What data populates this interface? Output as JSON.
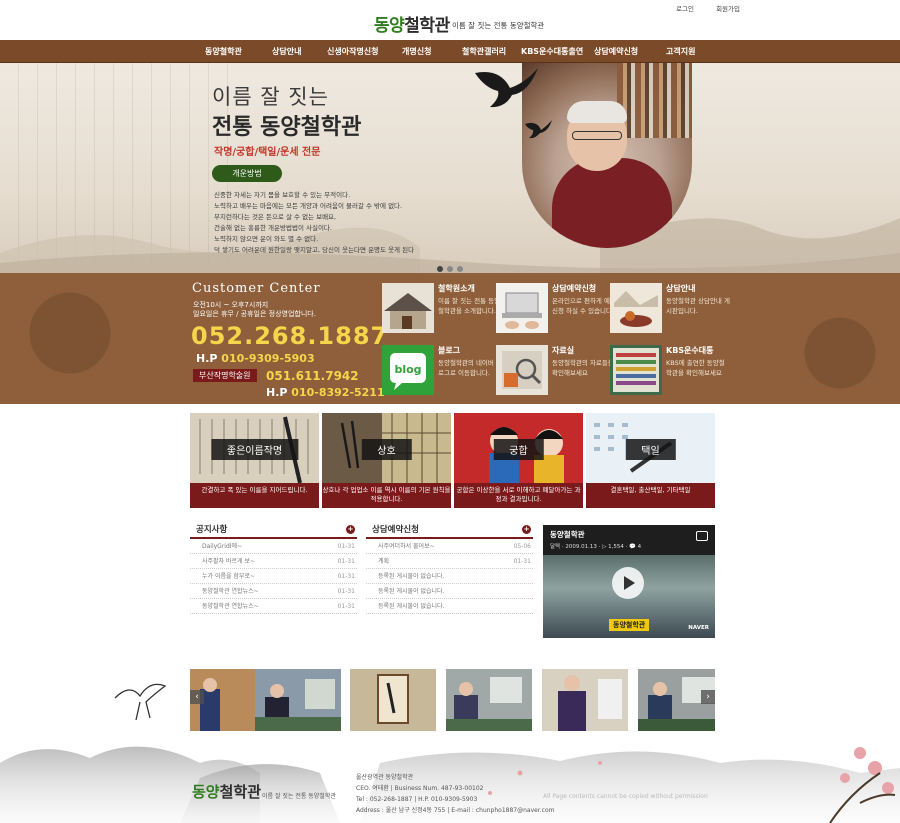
{
  "header": {
    "logo_main": "동양",
    "logo_dark": "철학관",
    "slogan": "이름 잘 짓는 전통 동양철학관",
    "login": "로그인",
    "join": "회원가입"
  },
  "nav": {
    "items": [
      "동양철학관",
      "상담안내",
      "신생아작명신청",
      "개명신청",
      "철학관갤러리",
      "KBS운수대통출연",
      "상담예약신청",
      "고객지원"
    ]
  },
  "hero": {
    "title1": "이름 잘 짓는",
    "title2": "전통 동양철학관",
    "subtitle": "작명/궁합/택일/운세 전문",
    "button": "개운방법",
    "lines": [
      "신중한 자세는 자기 몸을 보호할 수 있는 무적이다.",
      "노력하고 배우는 마음에는 모든 개양과 어려움이 물러갈 수 밖에 없다.",
      "부지런하다는 것은 돈으로 살 수 없는 보배요,",
      "건술해 없는 홍륭한 개운방법법이 사실이다.",
      "노력하지 않으면 운이 와도 별 수 없다.",
      "덕 쌓기도 어려운데 원한일랑 맺지말고, 당신이 웃는다면 운명도 웃게 된다"
    ]
  },
  "customer_center": {
    "title": "Customer Center",
    "hours1": "오전10시 ~ 오후7시까지",
    "hours2": "일요일은 휴무 / 공휴일은 정상영업합니다.",
    "phone": "052.268.1887",
    "hp1_label": "H.P",
    "hp1": "010-9309-5903",
    "branch": "부산작명학술원",
    "phone2": "051.611.7942",
    "hp2_label": "H.P",
    "hp2": "010-8392-5211"
  },
  "services": [
    {
      "title": "철학원소개",
      "desc": "이름 잘 짓는 전통 동양철학관을 소개합니다."
    },
    {
      "title": "상담예약신청",
      "desc": "온라인으로 편하게 예약신청 하실 수 있습니다."
    },
    {
      "title": "상담안내",
      "desc": "동양철학관 상담안내 게시판입니다."
    },
    {
      "title": "블로그",
      "desc": "동양철학관의 네이버 블로그로 이동합니다."
    },
    {
      "title": "자료실",
      "desc": "동양철학관의 자료들을 확인해보세요"
    },
    {
      "title": "KBS운수대통",
      "desc": "KBS에 출연한 동양철학관을 확인해보세요"
    }
  ],
  "blog_badge": "blog",
  "tiles": [
    {
      "label": "좋은이름작명",
      "cap": "간결하고 폭 있는 이름을 지어드립니다."
    },
    {
      "label": "상호",
      "cap": "상호나 각 업업소 이름 역시 이름의 기본 원칙을 적용합니다."
    },
    {
      "label": "궁합",
      "cap": "궁합은 이상한을 서로 이해하고 폐달아가는 과정과 결과입니다."
    },
    {
      "label": "택일",
      "cap": "결혼택일, 출산택일, 기타택일"
    }
  ],
  "board_notice": {
    "title": "공지사항",
    "more": "+",
    "rows": [
      {
        "t": "DailyGridl에~",
        "d": "01-31"
      },
      {
        "t": "사주팔자 바르게 보~",
        "d": "01-31"
      },
      {
        "t": "누가 이름을 함부로~",
        "d": "01-31"
      },
      {
        "t": "동양철학관 연합뉴스~",
        "d": "01-31"
      },
      {
        "t": "동양철학관 연합뉴스~",
        "d": "01-31"
      }
    ]
  },
  "board_reserve": {
    "title": "상담예약신청",
    "more": "+",
    "rows": [
      {
        "t": "사주여더하서 물어보~",
        "d": "05-06"
      },
      {
        "t": "계획",
        "d": "01-31"
      },
      {
        "t": "등록된 게시물이 없습니다.",
        "d": ""
      },
      {
        "t": "등록된 게시물이 없습니다.",
        "d": ""
      },
      {
        "t": "등록된 게시물이 없습니다.",
        "d": ""
      }
    ]
  },
  "video": {
    "title": "동양철학관",
    "meta": "달력 · 2009.01.13 · ▷ 1,554 · 💬 4",
    "label": "동양철학관",
    "brand": "NAVER"
  },
  "strip": {
    "prev": "‹",
    "next": "›"
  },
  "footer": {
    "logo_main": "동양",
    "logo_dark": "철학관",
    "slogan": "이름 잘 짓는 전통 동양철학관",
    "info1": "울산광역관 동양철학관",
    "info2": "CEO. 여태환 | Business Num. 487-93-00102",
    "info3": "Tel : 052-268-1887 | H.P. 010-9309-5903",
    "info4": "Address : 울산 남구 신정4동 755 | E-mail : chunpho1887@naver.com",
    "copyright": "All Page contents cannot be copied without permission"
  },
  "colors": {
    "brown": "#7b4a28",
    "maroon": "#7a1a1a",
    "green": "#2f7d1f",
    "gold": "#f7d54a"
  }
}
